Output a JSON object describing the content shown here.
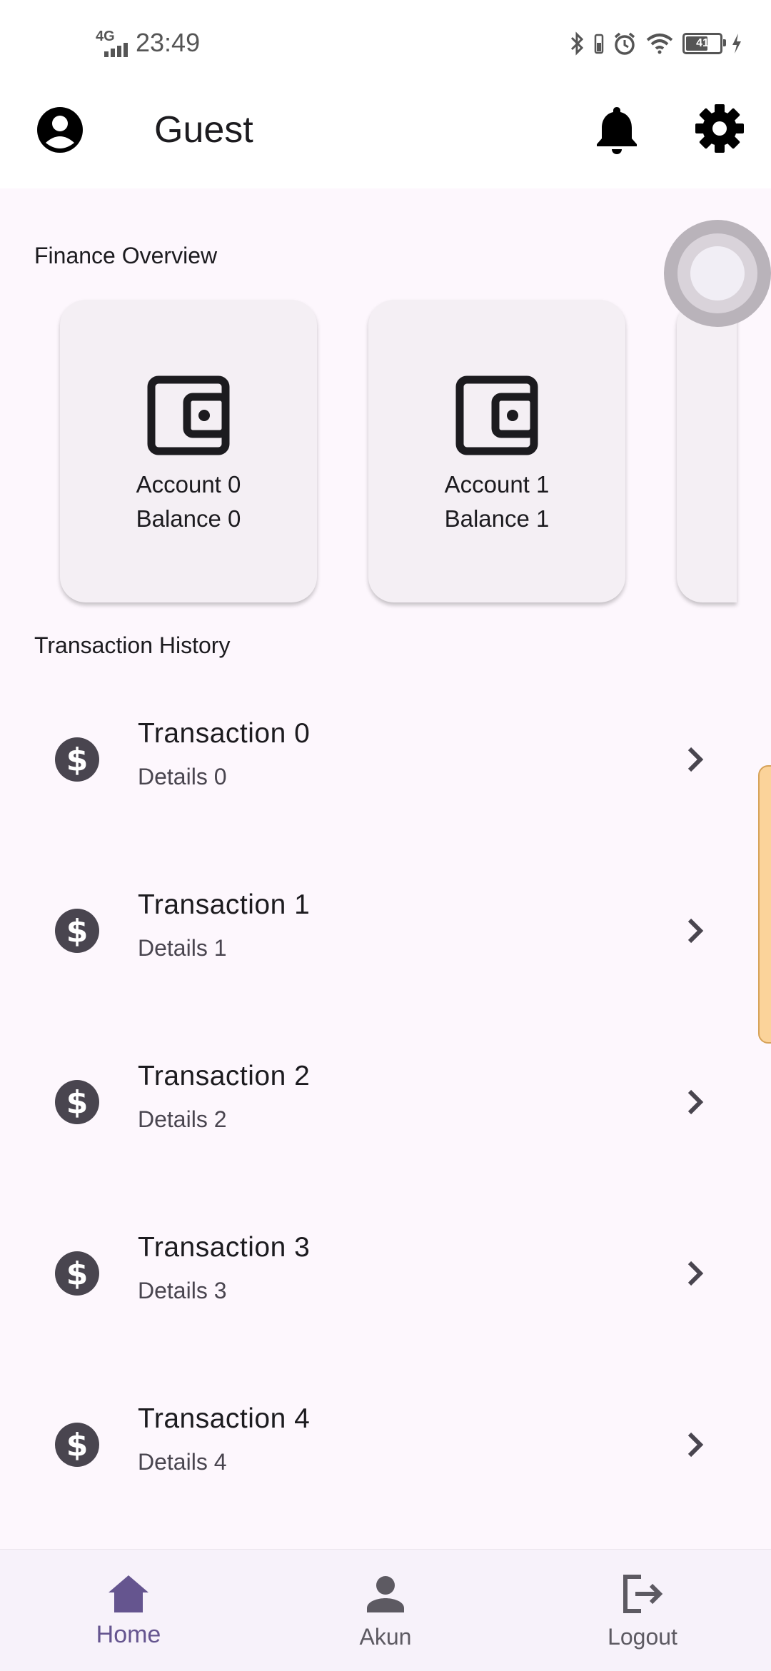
{
  "status_bar": {
    "network": "4G",
    "time": "23:49",
    "battery": "41"
  },
  "app_bar": {
    "title": "Guest"
  },
  "finance_overview": {
    "title": "Finance Overview",
    "cards": [
      {
        "account": "Account 0",
        "balance": "Balance 0",
        "icon": "wallet-icon"
      },
      {
        "account": "Account 1",
        "balance": "Balance 1",
        "icon": "wallet-icon"
      }
    ]
  },
  "transaction_history": {
    "title": "Transaction History",
    "items": [
      {
        "name": "Transaction 0",
        "details": "Details 0",
        "icon": "dollar-icon"
      },
      {
        "name": "Transaction 1",
        "details": "Details 1",
        "icon": "dollar-icon"
      },
      {
        "name": "Transaction 2",
        "details": "Details 2",
        "icon": "dollar-icon"
      },
      {
        "name": "Transaction 3",
        "details": "Details 3",
        "icon": "dollar-icon"
      },
      {
        "name": "Transaction 4",
        "details": "Details 4",
        "icon": "dollar-icon"
      }
    ]
  },
  "bottom_nav": {
    "items": [
      {
        "label": "Home",
        "icon": "home-icon",
        "active": true
      },
      {
        "label": "Akun",
        "icon": "person-icon",
        "active": false
      },
      {
        "label": "Logout",
        "icon": "logout-icon",
        "active": false
      }
    ]
  },
  "colors": {
    "background": "#fdf7fd",
    "card": "#f4eff4",
    "accent": "#65558f",
    "nav_background": "#f7f2fa"
  }
}
